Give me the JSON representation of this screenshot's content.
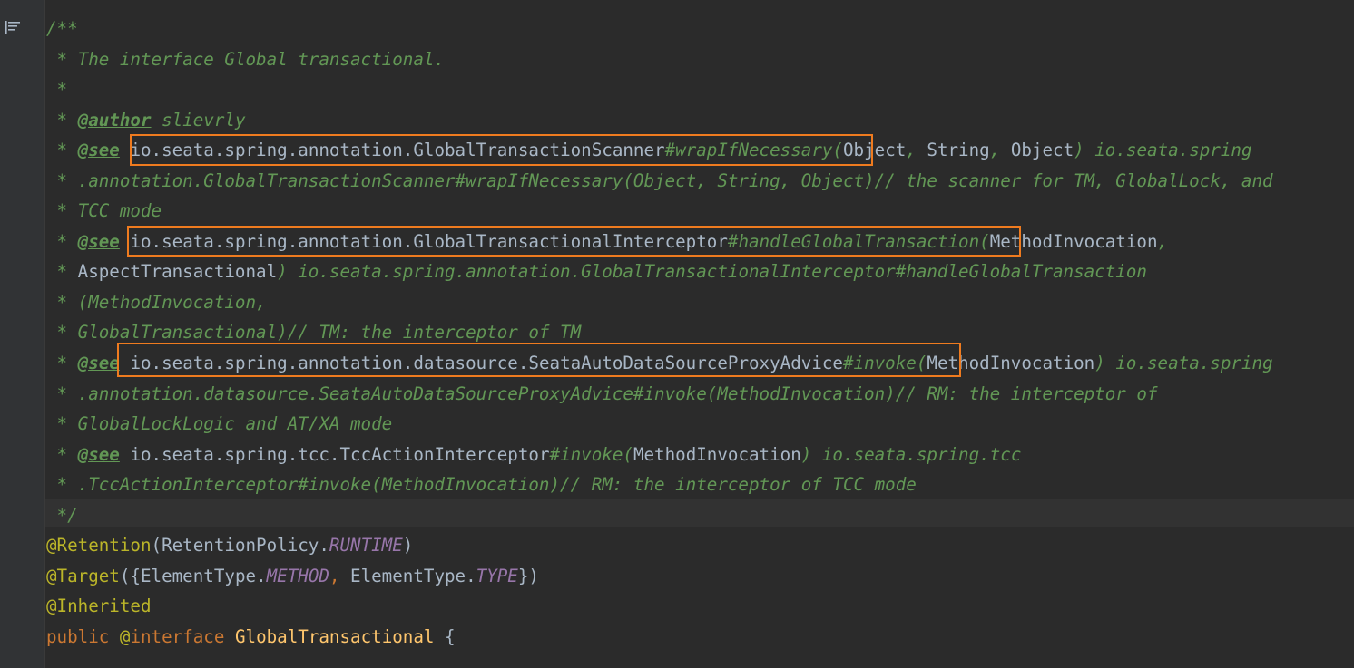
{
  "gutter": {
    "icon": "structure-list-icon"
  },
  "lines": [
    {
      "segments": [
        {
          "cls": "doc",
          "t": "/**"
        }
      ]
    },
    {
      "segments": [
        {
          "cls": "doc",
          "t": " * The interface Global transactional."
        }
      ]
    },
    {
      "segments": [
        {
          "cls": "doc",
          "t": " *"
        }
      ]
    },
    {
      "segments": [
        {
          "cls": "doc",
          "t": " * "
        },
        {
          "cls": "doctag",
          "t": "@author"
        },
        {
          "cls": "doc",
          "t": " slievrly"
        }
      ]
    },
    {
      "segments": [
        {
          "cls": "doc",
          "t": " * "
        },
        {
          "cls": "doctag",
          "t": "@see"
        },
        {
          "cls": "doc",
          "t": " "
        },
        {
          "cls": "docref-plain",
          "t": "io.seata.spring.annotation.GlobalTransactionScanner"
        },
        {
          "cls": "doc",
          "t": "#wrapIfNecessary("
        },
        {
          "cls": "docref-plain",
          "t": "Object"
        },
        {
          "cls": "doc",
          "t": ", "
        },
        {
          "cls": "docref-plain",
          "t": "String"
        },
        {
          "cls": "doc",
          "t": ", "
        },
        {
          "cls": "docref-plain",
          "t": "Object"
        },
        {
          "cls": "doc",
          "t": ") io.seata.spring"
        }
      ]
    },
    {
      "segments": [
        {
          "cls": "doc",
          "t": " * .annotation.GlobalTransactionScanner#wrapIfNecessary(Object, String, Object)// the scanner for TM, GlobalLock, and"
        }
      ]
    },
    {
      "segments": [
        {
          "cls": "doc",
          "t": " * TCC mode"
        }
      ]
    },
    {
      "segments": [
        {
          "cls": "doc",
          "t": " * "
        },
        {
          "cls": "doctag",
          "t": "@see"
        },
        {
          "cls": "doc",
          "t": " "
        },
        {
          "cls": "docref-plain",
          "t": "io.seata.spring.annotation.GlobalTransactionalInterceptor"
        },
        {
          "cls": "doc",
          "t": "#handleGlobalTransaction("
        },
        {
          "cls": "docref-plain",
          "t": "MethodInvocation"
        },
        {
          "cls": "doc",
          "t": ","
        }
      ]
    },
    {
      "segments": [
        {
          "cls": "doc",
          "t": " * "
        },
        {
          "cls": "docref-plain",
          "t": "AspectTransactional"
        },
        {
          "cls": "doc",
          "t": ") io.seata.spring.annotation.GlobalTransactionalInterceptor#handleGlobalTransaction"
        }
      ]
    },
    {
      "segments": [
        {
          "cls": "doc",
          "t": " * (MethodInvocation,"
        }
      ]
    },
    {
      "segments": [
        {
          "cls": "doc",
          "t": " * GlobalTransactional)// TM: the interceptor of TM"
        }
      ]
    },
    {
      "segments": [
        {
          "cls": "doc",
          "t": " * "
        },
        {
          "cls": "doctag",
          "t": "@see"
        },
        {
          "cls": "doc",
          "t": " "
        },
        {
          "cls": "docref-plain",
          "t": "io.seata.spring.annotation.datasource.SeataAutoDataSourceProxyAdvice"
        },
        {
          "cls": "doc",
          "t": "#invoke("
        },
        {
          "cls": "docref-plain",
          "t": "MethodInvocation"
        },
        {
          "cls": "doc",
          "t": ") io.seata.spring"
        }
      ]
    },
    {
      "segments": [
        {
          "cls": "doc",
          "t": " * .annotation.datasource.SeataAutoDataSourceProxyAdvice#invoke(MethodInvocation)// RM: the interceptor of"
        }
      ]
    },
    {
      "segments": [
        {
          "cls": "doc",
          "t": " * GlobalLockLogic and AT/XA mode"
        }
      ]
    },
    {
      "segments": [
        {
          "cls": "doc",
          "t": " * "
        },
        {
          "cls": "doctag",
          "t": "@see"
        },
        {
          "cls": "doc",
          "t": " "
        },
        {
          "cls": "docref-plain",
          "t": "io.seata.spring.tcc.TccActionInterceptor"
        },
        {
          "cls": "doc",
          "t": "#invoke("
        },
        {
          "cls": "docref-plain",
          "t": "MethodInvocation"
        },
        {
          "cls": "doc",
          "t": ") io.seata.spring.tcc"
        }
      ]
    },
    {
      "segments": [
        {
          "cls": "doc",
          "t": " * .TccActionInterceptor#invoke(MethodInvocation)// RM: the interceptor of TCC mode"
        }
      ]
    },
    {
      "segments": [
        {
          "cls": "doc",
          "t": " */"
        }
      ]
    },
    {
      "segments": [
        {
          "cls": "ann",
          "t": "@Retention"
        },
        {
          "cls": "plain",
          "t": "(RetentionPolicy."
        },
        {
          "cls": "const",
          "t": "RUNTIME"
        },
        {
          "cls": "plain",
          "t": ")"
        }
      ]
    },
    {
      "segments": [
        {
          "cls": "ann",
          "t": "@Target"
        },
        {
          "cls": "plain",
          "t": "({ElementType."
        },
        {
          "cls": "const",
          "t": "METHOD"
        },
        {
          "cls": "kw",
          "t": ", "
        },
        {
          "cls": "plain",
          "t": "ElementType."
        },
        {
          "cls": "const",
          "t": "TYPE"
        },
        {
          "cls": "plain",
          "t": "})"
        }
      ]
    },
    {
      "segments": [
        {
          "cls": "ann",
          "t": "@Inherited"
        }
      ]
    },
    {
      "segments": [
        {
          "cls": "kw",
          "t": "public "
        },
        {
          "cls": "ann",
          "t": "@"
        },
        {
          "cls": "kw",
          "t": "interface "
        },
        {
          "cls": "cls",
          "t": "GlobalTransactional"
        },
        {
          "cls": "plain",
          "t": " {"
        }
      ]
    }
  ],
  "colors": {
    "background": "#2b2b2b",
    "gutter": "#313335",
    "doc_comment": "#629755",
    "annotation": "#bbb529",
    "keyword": "#cc7832",
    "constant": "#9876aa",
    "highlight_box": "#ef7b1f"
  }
}
